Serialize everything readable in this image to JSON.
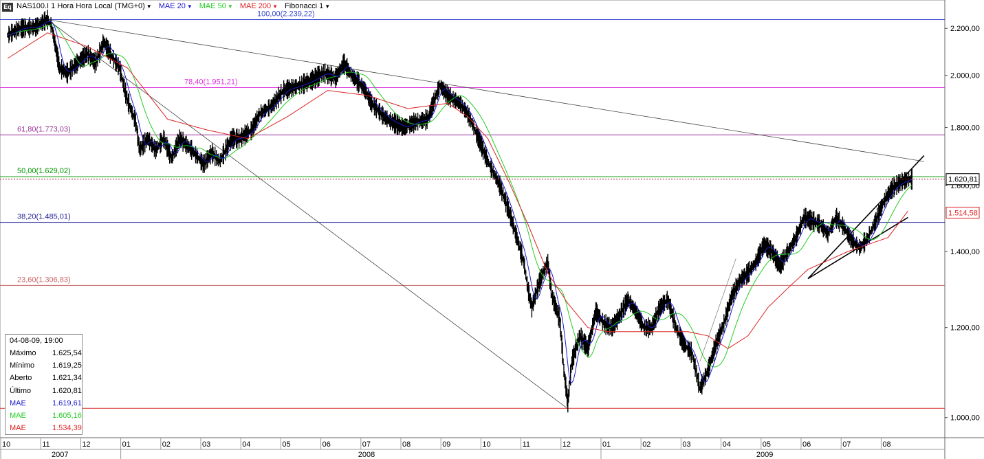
{
  "toolbar": {
    "app_icon": "Eq",
    "symbol": "NAS100.I 1 Hora Hora Local (TMG+0)",
    "mae20": "MAE 20",
    "mae50": "MAE 50",
    "mae200": "MAE 200",
    "fib": "Fibonacci 1",
    "dropdown_icon": "caret-down-icon"
  },
  "colors": {
    "price": "#000000",
    "mae20": "#1a1acc",
    "mae50": "#22cc22",
    "mae200": "#dd2222",
    "fib_100": "#3344cc",
    "fib_78": "#dd33dd",
    "fib_61": "#993399",
    "fib_50": "#009900",
    "fib_38": "#222299",
    "fib_23": "#cc6666",
    "fib_0": "#dd3333"
  },
  "chart_data": {
    "type": "line",
    "title": "NAS100.I 1 Hora",
    "y_scale": "log",
    "ylim": [
      960,
      2330
    ],
    "y_ticks": [
      "2.200,00",
      "2.000,00",
      "1.800,00",
      "1.600,00",
      "1.400,00",
      "1.200,00",
      "1.000,00"
    ],
    "y_tick_values": [
      2200,
      2000,
      1800,
      1600,
      1400,
      1200,
      1000
    ],
    "x_months": [
      "10",
      "11",
      "12",
      "01",
      "02",
      "03",
      "04",
      "05",
      "06",
      "07",
      "08",
      "09",
      "10",
      "11",
      "12",
      "01",
      "02",
      "03",
      "04",
      "05",
      "06",
      "07",
      "08"
    ],
    "x_years": [
      "2007",
      "2008",
      "2009"
    ],
    "price_series": [
      [
        0,
        2170
      ],
      [
        0.3,
        2200
      ],
      [
        0.7,
        2205
      ],
      [
        0.9,
        2230
      ],
      [
        1.0,
        2240
      ],
      [
        1.1,
        2210
      ],
      [
        1.2,
        2120
      ],
      [
        1.3,
        2030
      ],
      [
        1.5,
        2010
      ],
      [
        1.8,
        2060
      ],
      [
        2.0,
        2090
      ],
      [
        2.2,
        2050
      ],
      [
        2.4,
        2140
      ],
      [
        2.6,
        2080
      ],
      [
        2.8,
        2030
      ],
      [
        2.9,
        1960
      ],
      [
        3.0,
        1900
      ],
      [
        3.2,
        1820
      ],
      [
        3.3,
        1720
      ],
      [
        3.5,
        1760
      ],
      [
        3.7,
        1720
      ],
      [
        3.9,
        1760
      ],
      [
        4.1,
        1690
      ],
      [
        4.3,
        1760
      ],
      [
        4.6,
        1720
      ],
      [
        4.9,
        1670
      ],
      [
        5.1,
        1710
      ],
      [
        5.3,
        1680
      ],
      [
        5.6,
        1760
      ],
      [
        5.8,
        1760
      ],
      [
        6.1,
        1790
      ],
      [
        6.3,
        1850
      ],
      [
        6.6,
        1880
      ],
      [
        6.9,
        1940
      ],
      [
        7.3,
        1960
      ],
      [
        7.6,
        1980
      ],
      [
        7.9,
        2010
      ],
      [
        8.2,
        1990
      ],
      [
        8.4,
        2050
      ],
      [
        8.6,
        2000
      ],
      [
        8.9,
        1950
      ],
      [
        9.1,
        1890
      ],
      [
        9.4,
        1840
      ],
      [
        9.6,
        1820
      ],
      [
        9.9,
        1800
      ],
      [
        10.2,
        1820
      ],
      [
        10.5,
        1830
      ],
      [
        10.8,
        1960
      ],
      [
        11.0,
        1920
      ],
      [
        11.3,
        1890
      ],
      [
        11.5,
        1850
      ],
      [
        11.8,
        1750
      ],
      [
        12.0,
        1680
      ],
      [
        12.3,
        1600
      ],
      [
        12.5,
        1530
      ],
      [
        12.7,
        1450
      ],
      [
        12.9,
        1370
      ],
      [
        13.0,
        1300
      ],
      [
        13.1,
        1250
      ],
      [
        13.3,
        1320
      ],
      [
        13.5,
        1370
      ],
      [
        13.6,
        1280
      ],
      [
        13.8,
        1220
      ],
      [
        13.9,
        1100
      ],
      [
        14.0,
        1030
      ],
      [
        14.1,
        1120
      ],
      [
        14.3,
        1180
      ],
      [
        14.5,
        1150
      ],
      [
        14.7,
        1240
      ],
      [
        14.9,
        1210
      ],
      [
        15.1,
        1200
      ],
      [
        15.3,
        1230
      ],
      [
        15.5,
        1270
      ],
      [
        15.7,
        1240
      ],
      [
        15.9,
        1200
      ],
      [
        16.1,
        1200
      ],
      [
        16.3,
        1250
      ],
      [
        16.5,
        1270
      ],
      [
        16.7,
        1200
      ],
      [
        16.9,
        1160
      ],
      [
        17.1,
        1140
      ],
      [
        17.3,
        1060
      ],
      [
        17.5,
        1100
      ],
      [
        17.7,
        1160
      ],
      [
        17.9,
        1210
      ],
      [
        18.1,
        1280
      ],
      [
        18.3,
        1320
      ],
      [
        18.5,
        1340
      ],
      [
        18.7,
        1370
      ],
      [
        18.9,
        1420
      ],
      [
        19.1,
        1400
      ],
      [
        19.3,
        1360
      ],
      [
        19.5,
        1400
      ],
      [
        19.7,
        1440
      ],
      [
        19.9,
        1500
      ],
      [
        20.1,
        1490
      ],
      [
        20.3,
        1480
      ],
      [
        20.5,
        1450
      ],
      [
        20.7,
        1500
      ],
      [
        20.9,
        1470
      ],
      [
        21.1,
        1430
      ],
      [
        21.3,
        1410
      ],
      [
        21.5,
        1440
      ],
      [
        21.7,
        1490
      ],
      [
        21.9,
        1550
      ],
      [
        22.1,
        1590
      ],
      [
        22.3,
        1610
      ],
      [
        22.5,
        1620
      ],
      [
        22.6,
        1621
      ]
    ],
    "mae200_series": [
      [
        0,
        2070
      ],
      [
        1.0,
        2180
      ],
      [
        2.0,
        2120
      ],
      [
        3.0,
        2030
      ],
      [
        4.0,
        1830
      ],
      [
        5.0,
        1790
      ],
      [
        6.0,
        1760
      ],
      [
        7.0,
        1840
      ],
      [
        8.0,
        1940
      ],
      [
        9.0,
        1920
      ],
      [
        10.0,
        1870
      ],
      [
        11.0,
        1890
      ],
      [
        11.5,
        1840
      ],
      [
        12.0,
        1760
      ],
      [
        12.5,
        1620
      ],
      [
        13.0,
        1480
      ],
      [
        13.5,
        1340
      ],
      [
        14.0,
        1260
      ],
      [
        14.5,
        1200
      ],
      [
        15.0,
        1190
      ],
      [
        16.0,
        1190
      ],
      [
        17.0,
        1190
      ],
      [
        17.5,
        1180
      ],
      [
        18.0,
        1150
      ],
      [
        18.5,
        1180
      ],
      [
        19.0,
        1250
      ],
      [
        19.5,
        1300
      ],
      [
        20.0,
        1350
      ],
      [
        21.0,
        1400
      ],
      [
        21.5,
        1420
      ],
      [
        22.0,
        1440
      ],
      [
        22.5,
        1520
      ]
    ],
    "fib_levels": [
      {
        "pct": "100,00",
        "value": 2239.22,
        "label": "100,00(2.239,22)",
        "color_key": "fib_100"
      },
      {
        "pct": "78,40",
        "value": 1951.21,
        "label": "78,40(1.951,21)",
        "color_key": "fib_78"
      },
      {
        "pct": "61,80",
        "value": 1773.03,
        "label": "61,80(1.773,03)",
        "color_key": "fib_61"
      },
      {
        "pct": "50,00",
        "value": 1629.02,
        "label": "50,00(1.629,02)",
        "color_key": "fib_50"
      },
      {
        "pct": "38,20",
        "value": 1485.01,
        "label": "38,20(1.485,01)",
        "color_key": "fib_38"
      },
      {
        "pct": "23,60",
        "value": 1306.83,
        "label": "23,60(1.306,83)",
        "color_key": "fib_23"
      },
      {
        "pct": "0,00",
        "value": 1018.8,
        "label": "",
        "color_key": "fib_0"
      }
    ],
    "trendlines": [
      {
        "from": [
          1.0,
          2239
        ],
        "to": [
          22.9,
          1680
        ],
        "color": "#444444"
      },
      {
        "from": [
          1.0,
          2239
        ],
        "to": [
          14.0,
          1018
        ],
        "color": "#444444"
      },
      {
        "from": [
          20.0,
          1325
        ],
        "to": [
          22.9,
          1700
        ],
        "color": "#000000"
      },
      {
        "from": [
          20.0,
          1325
        ],
        "to": [
          22.5,
          1500
        ],
        "color": "#000000"
      },
      {
        "from": [
          17.3,
          1120
        ],
        "to": [
          18.2,
          1380
        ],
        "color": "#888888"
      }
    ],
    "current_price": 1620.81,
    "current_price_label": "1.620,81",
    "mae200_label": "1.514,58",
    "mae200_value": 1514.58
  },
  "info": {
    "datetime": "04-08-09, 19:00",
    "rows": [
      {
        "label": "Máximo",
        "value": "1.625,54",
        "color": "#000000"
      },
      {
        "label": "Mínimo",
        "value": "1.619,25",
        "color": "#000000"
      },
      {
        "label": "Aberto",
        "value": "1.621,34",
        "color": "#000000"
      },
      {
        "label": "Último",
        "value": "1.620,81",
        "color": "#000000"
      },
      {
        "label": "MAE",
        "value": "1.619,61",
        "color": "#1a1acc"
      },
      {
        "label": "MAE",
        "value": "1.605,16",
        "color": "#22cc22"
      },
      {
        "label": "MAE",
        "value": "1.534,39",
        "color": "#dd2222"
      }
    ]
  }
}
